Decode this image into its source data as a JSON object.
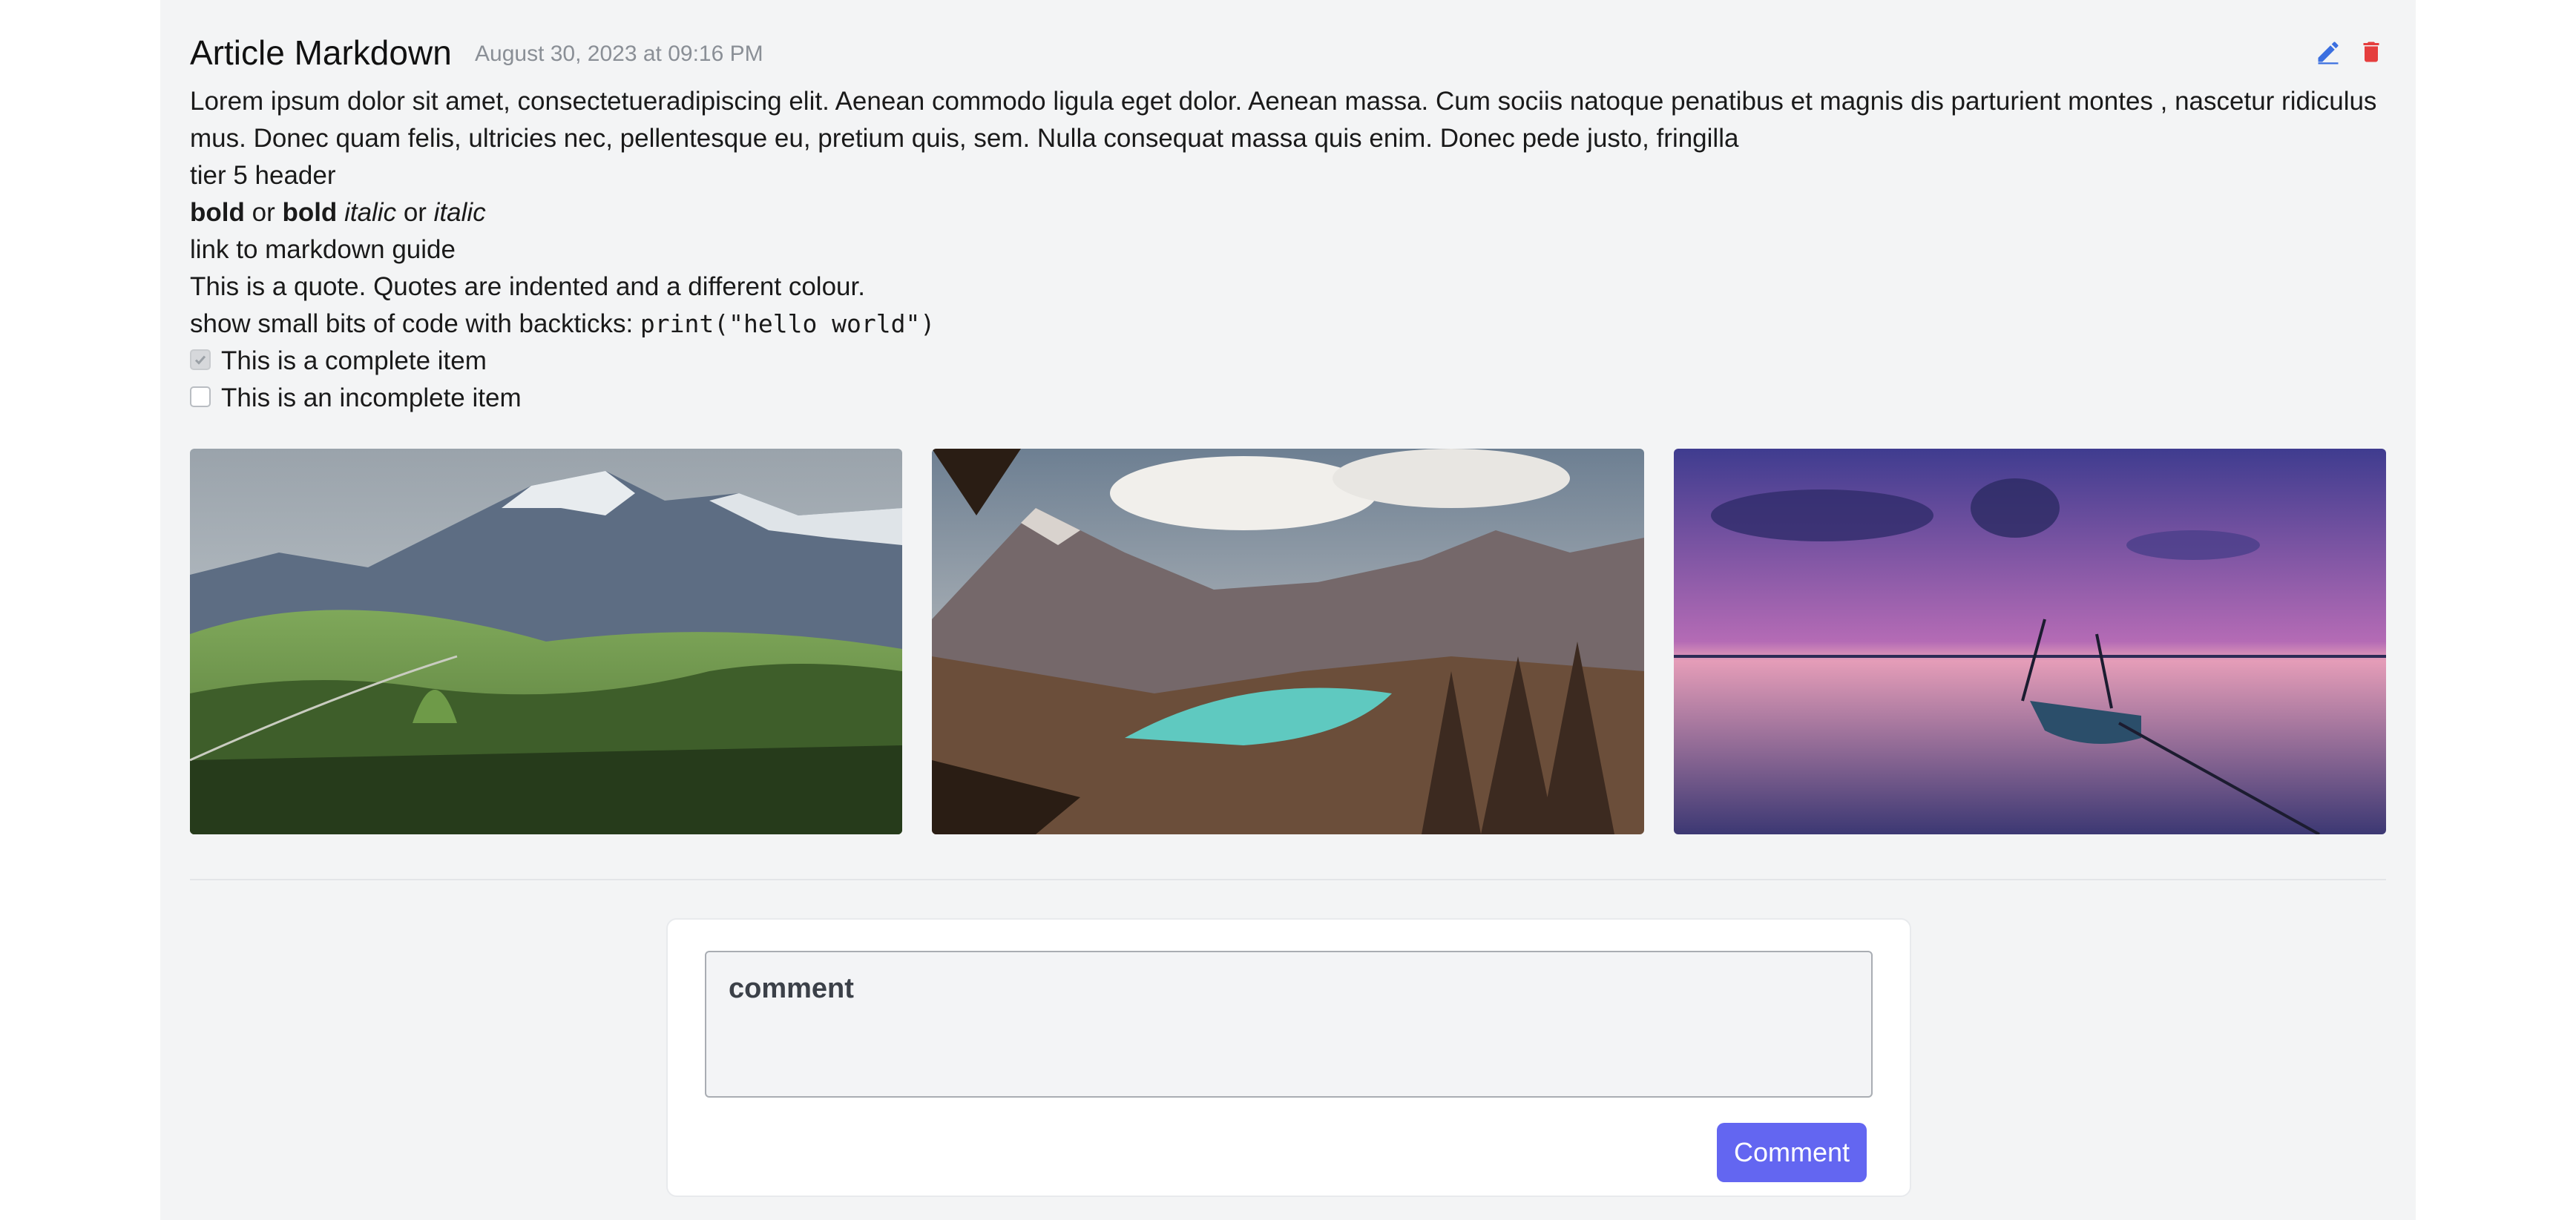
{
  "post": {
    "title": "Article Markdown",
    "date": "August 30, 2023 at 09:16 PM",
    "body": {
      "paragraph": "Lorem ipsum dolor sit amet, consectetueradipiscing elit. Aenean commodo ligula eget dolor. Aenean massa. Cum sociis natoque penatibus et magnis dis parturient montes , nascetur ridiculus mus. Donec quam felis, ultricies nec, pellentesque eu, pretium quis, sem. Nulla consequat massa quis enim. Donec pede justo, fringilla",
      "header_line": "tier 5 header",
      "emphasis": {
        "bold1": "bold",
        "or1": " or ",
        "bold2": "bold",
        "italic1": "italic",
        "or2": " or ",
        "italic2": "italic"
      },
      "link_text": "link to markdown guide",
      "quote": "This is a quote. Quotes are indented and a different colour.",
      "code_prefix": "show small bits of code with backticks: ",
      "code": "print(\"hello world\")",
      "tasks": [
        {
          "label": "This is a complete item",
          "checked": true
        },
        {
          "label": "This is an incomplete item",
          "checked": false
        }
      ]
    },
    "images": [
      "mountain-meadow",
      "mountain-lake",
      "sunset-boat"
    ]
  },
  "icons": {
    "edit": "pencil-icon",
    "delete": "trash-icon"
  },
  "colors": {
    "edit": "#3b6fe0",
    "delete": "#e53e3e",
    "accent": "#6366f1"
  },
  "comment_form": {
    "placeholder": "comment",
    "submit_label": "Comment"
  }
}
